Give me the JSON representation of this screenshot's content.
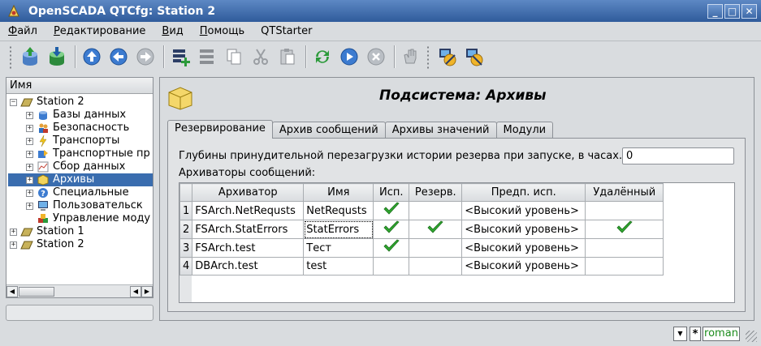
{
  "window": {
    "title": "OpenSCADA QTCfg: Station 2",
    "buttons": [
      "_",
      "□",
      "✕"
    ]
  },
  "menu": {
    "items": [
      {
        "u": "Ф",
        "rest": "айл"
      },
      {
        "u": "Р",
        "rest": "едактирование"
      },
      {
        "u": "В",
        "rest": "ид"
      },
      {
        "u": "П",
        "rest": "омощь"
      },
      {
        "u": "",
        "rest": "QTStarter"
      }
    ]
  },
  "tree": {
    "header": "Имя",
    "items": [
      {
        "label": "Station 2"
      },
      {
        "label": "Базы данных"
      },
      {
        "label": "Безопасность"
      },
      {
        "label": "Транспорты"
      },
      {
        "label": "Транспортные пр"
      },
      {
        "label": "Сбор данных"
      },
      {
        "label": "Архивы"
      },
      {
        "label": "Специальные"
      },
      {
        "label": "Пользовательск"
      },
      {
        "label": "Управление моду"
      },
      {
        "label": "Station 1"
      },
      {
        "label": "Station 2"
      }
    ]
  },
  "page": {
    "title": "Подсистема: Архивы",
    "tabs": [
      "Резервирование",
      "Архив сообщений",
      "Архивы значений",
      "Модули"
    ],
    "depth_label": "Глубины принудительной перезагрузки истории резерва при запуске, в часах.:",
    "depth_value": "0",
    "archivers_label": "Архиваторы сообщений:",
    "table": {
      "headers": [
        "Архиватор",
        "Имя",
        "Исп.",
        "Резерв.",
        "Предп. исп.",
        "Удалённый"
      ],
      "rows": [
        {
          "num": "1",
          "archiver": "FSArch.NetRequsts",
          "name": "NetRequsts",
          "use": true,
          "reserve": false,
          "pref": "<Высокий уровень>",
          "remote": false
        },
        {
          "num": "2",
          "archiver": "FSArch.StatErrors",
          "name": "StatErrors",
          "use": true,
          "reserve": true,
          "pref": "<Высокий уровень>",
          "remote": true
        },
        {
          "num": "3",
          "archiver": "FSArch.test",
          "name": "Тест",
          "use": true,
          "reserve": false,
          "pref": "<Высокий уровень>",
          "remote": false
        },
        {
          "num": "4",
          "archiver": "DBArch.test",
          "name": "test",
          "use": false,
          "reserve": false,
          "pref": "<Высокий уровень>",
          "remote": false
        }
      ]
    }
  },
  "status": {
    "star": "*",
    "user": "roman"
  },
  "colors": {
    "check": "#2fa82f",
    "selection": "#3a6daf",
    "title_bar": "#3f6cab"
  }
}
